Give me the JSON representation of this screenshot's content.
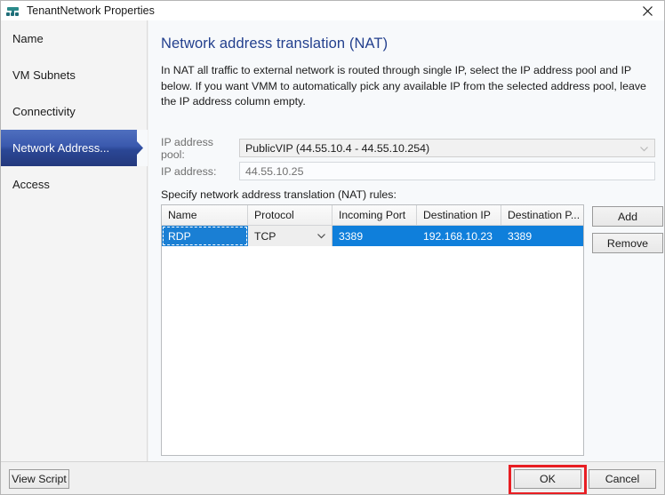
{
  "window": {
    "title": "TenantNetwork Properties",
    "icon": "network-node-icon",
    "close_label": "✕"
  },
  "sidebar": {
    "items": [
      {
        "label": "Name",
        "selected": false
      },
      {
        "label": "VM Subnets",
        "selected": false
      },
      {
        "label": "Connectivity",
        "selected": false
      },
      {
        "label": "Network Address...",
        "selected": true
      },
      {
        "label": "Access",
        "selected": false
      }
    ]
  },
  "content": {
    "page_title": "Network address translation (NAT)",
    "description": "In NAT all traffic to external network is routed through single IP, select the IP address pool and IP below. If you want VMM to automatically pick any available IP from the selected address pool, leave the IP address column empty.",
    "fields": {
      "pool_label": "IP address pool:",
      "pool_value": "PublicVIP (44.55.10.4 - 44.55.10.254)",
      "ip_label": "IP address:",
      "ip_value": "44.55.10.25"
    },
    "rules_label": "Specify network address translation (NAT) rules:",
    "grid": {
      "columns": [
        "Name",
        "Protocol",
        "Incoming Port",
        "Destination IP",
        "Destination P..."
      ],
      "rows": [
        {
          "name": "RDP",
          "protocol": "TCP",
          "incoming_port": "3389",
          "destination_ip": "192.168.10.23",
          "destination_port": "3389",
          "selected": true
        }
      ]
    },
    "buttons": {
      "add": "Add",
      "remove": "Remove"
    }
  },
  "footer": {
    "view_script": "View Script",
    "ok": "OK",
    "cancel": "Cancel"
  },
  "colors": {
    "accent_blue": "#0f7fdb",
    "title_navy": "#23408e",
    "highlight_red": "#e81e23",
    "sidebar_selected_top": "#4f6fbf",
    "sidebar_selected_bottom": "#24397d"
  }
}
